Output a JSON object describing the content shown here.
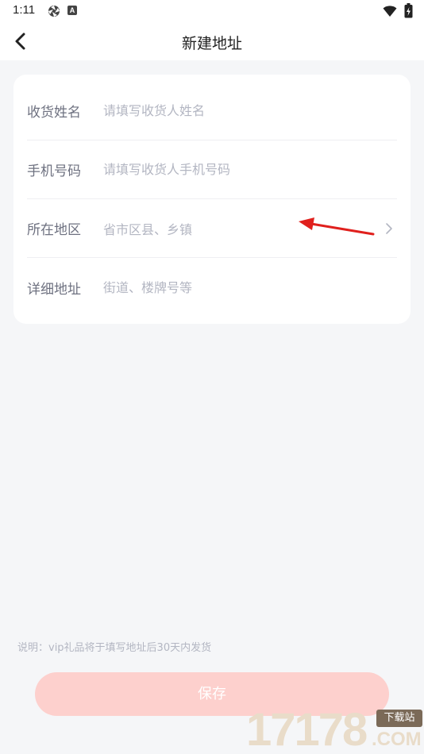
{
  "status_bar": {
    "time": "1:11",
    "badge": "A"
  },
  "header": {
    "title": "新建地址"
  },
  "form": {
    "rows": [
      {
        "label": "收货姓名",
        "placeholder": "请填写收货人姓名"
      },
      {
        "label": "手机号码",
        "placeholder": "请填写收货人手机号码"
      },
      {
        "label": "所在地区",
        "placeholder": "省市区县、乡镇"
      },
      {
        "label": "详细地址",
        "placeholder": "街道、楼牌号等"
      }
    ]
  },
  "note": "说明：vip礼品将于填写地址后30天内发货",
  "save_label": "保存",
  "watermark": {
    "digits": "17178",
    "tag": "下载站",
    "com": ".COM"
  },
  "colors": {
    "background": "#f5f6f8",
    "card": "#ffffff",
    "label": "#6e7180",
    "placeholder": "#b3b6c2",
    "save_button": "#fdd0cd",
    "annotation_arrow": "#e0201d"
  },
  "icons": {
    "back": "chevron-left-icon",
    "region_picker": "chevron-right-icon",
    "status": [
      "aperture-icon",
      "a-badge-icon",
      "wifi-icon",
      "battery-charging-icon"
    ]
  }
}
